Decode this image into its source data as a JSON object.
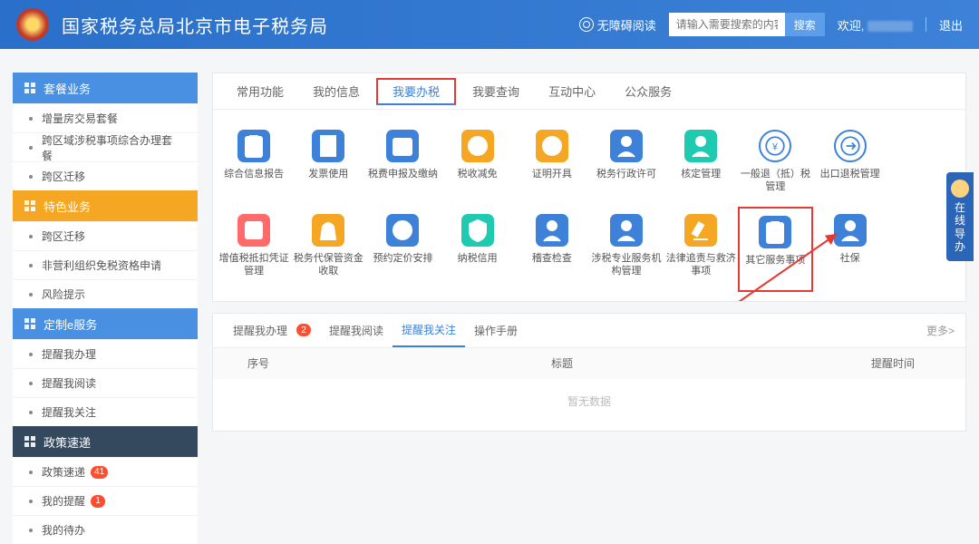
{
  "header": {
    "title": "国家税务总局北京市电子税务局",
    "accessible_label": "无障碍阅读",
    "search_placeholder": "请输入需要搜索的内容",
    "search_btn": "搜索",
    "welcome": "欢迎,",
    "logout": "退出"
  },
  "sidebar": {
    "groups": [
      {
        "title": "套餐业务",
        "color": "blue",
        "icon": "grid",
        "items": [
          {
            "label": "增量房交易套餐"
          },
          {
            "label": "跨区域涉税事项综合办理套餐"
          },
          {
            "label": "跨区迁移"
          }
        ]
      },
      {
        "title": "特色业务",
        "color": "orange",
        "icon": "grid",
        "items": [
          {
            "label": "跨区迁移"
          },
          {
            "label": "非营利组织免税资格申请"
          },
          {
            "label": "风险提示"
          }
        ]
      },
      {
        "title": "定制e服务",
        "color": "blue",
        "icon": "user",
        "items": [
          {
            "label": "提醒我办理"
          },
          {
            "label": "提醒我阅读"
          },
          {
            "label": "提醒我关注"
          }
        ]
      },
      {
        "title": "政策速递",
        "color": "dark",
        "icon": "doc",
        "items": [
          {
            "label": "政策速递",
            "badge": "41"
          },
          {
            "label": "我的提醒",
            "badge": "1"
          },
          {
            "label": "我的待办"
          }
        ]
      }
    ]
  },
  "main": {
    "tabs": [
      {
        "label": "常用功能"
      },
      {
        "label": "我的信息"
      },
      {
        "label": "我要办税",
        "active": true,
        "highlight": true
      },
      {
        "label": "我要查询"
      },
      {
        "label": "互动中心"
      },
      {
        "label": "公众服务"
      }
    ],
    "grid": [
      {
        "label": "综合信息报告",
        "color": "c-blue",
        "glyph": "clipboard"
      },
      {
        "label": "发票使用",
        "color": "c-blue",
        "glyph": "receipt"
      },
      {
        "label": "税费申报及缴纳",
        "color": "c-blue",
        "glyph": "calendar"
      },
      {
        "label": "税收减免",
        "color": "c-orange",
        "glyph": "coin"
      },
      {
        "label": "证明开具",
        "color": "c-orange",
        "glyph": "stamp"
      },
      {
        "label": "税务行政许可",
        "color": "c-blue",
        "glyph": "person"
      },
      {
        "label": "核定管理",
        "color": "c-teal",
        "glyph": "person"
      },
      {
        "label": "一般退（抵）税管理",
        "color": "c-ring",
        "glyph": "refund"
      },
      {
        "label": "出口退税管理",
        "color": "c-ring",
        "glyph": "export"
      },
      {
        "label": "",
        "color": "",
        "glyph": ""
      },
      {
        "label": "增值税抵扣凭证管理",
        "color": "c-red",
        "glyph": "book"
      },
      {
        "label": "税务代保管资金收取",
        "color": "c-orange",
        "glyph": "bag"
      },
      {
        "label": "预约定价安排",
        "color": "c-blue",
        "glyph": "clock"
      },
      {
        "label": "纳税信用",
        "color": "c-teal",
        "glyph": "shield"
      },
      {
        "label": "稽查检查",
        "color": "c-blue",
        "glyph": "person"
      },
      {
        "label": "涉税专业服务机构管理",
        "color": "c-blue",
        "glyph": "person"
      },
      {
        "label": "法律追责与救济事项",
        "color": "c-orange",
        "glyph": "gavel"
      },
      {
        "label": "其它服务事项",
        "color": "c-blue",
        "glyph": "clipboard",
        "highlight": true
      },
      {
        "label": "社保",
        "color": "c-blue",
        "glyph": "person"
      }
    ]
  },
  "reminder": {
    "tabs": [
      {
        "label": "提醒我办理",
        "badge": "2"
      },
      {
        "label": "提醒我阅读"
      },
      {
        "label": "提醒我关注",
        "active": true
      },
      {
        "label": "操作手册"
      }
    ],
    "more": "更多>",
    "columns": {
      "seq": "序号",
      "title": "标题",
      "time": "提醒时间"
    },
    "empty": "暂无数据"
  },
  "float": {
    "line1": "在",
    "line2": "线",
    "line3": "导",
    "line4": "办"
  }
}
